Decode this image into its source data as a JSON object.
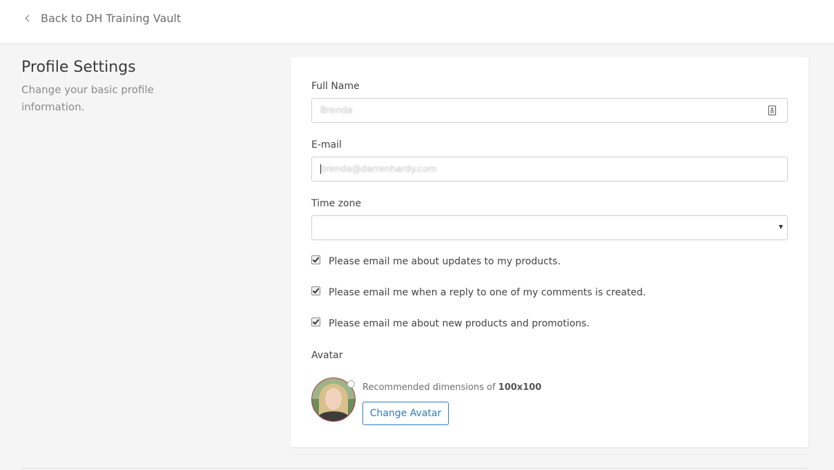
{
  "header": {
    "back_label": "Back to DH Training Vault"
  },
  "sidebar": {
    "title": "Profile Settings",
    "description": "Change your basic profile information."
  },
  "form": {
    "full_name_label": "Full Name",
    "full_name_value": "Brenda",
    "email_label": "E-mail",
    "email_value": "brenda@darrenhardy.com",
    "timezone_label": "Time zone",
    "timezone_value": "",
    "checkboxes": [
      {
        "label": "Please email me about updates to my products.",
        "checked": true
      },
      {
        "label": "Please email me when a reply to one of my comments is created.",
        "checked": true
      },
      {
        "label": "Please email me about new products and promotions.",
        "checked": true
      }
    ],
    "avatar_label": "Avatar",
    "avatar_recommendation_prefix": "Recommended dimensions of",
    "avatar_recommendation_size": "100x100",
    "change_avatar_label": "Change Avatar"
  },
  "icons": {
    "back": "chevron-left-icon",
    "contact": "contact-card-icon",
    "dropdown": "caret-down-icon",
    "avatar_badge": "clock-icon"
  },
  "colors": {
    "accent": "#2c7cc5",
    "background": "#f5f5f5",
    "card": "#ffffff"
  }
}
